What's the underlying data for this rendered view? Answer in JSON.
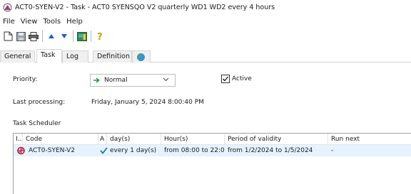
{
  "window": {
    "title": "ACT0-SYEN-V2 - Task - ACT0 SYENSQO  V2 quarterly WD1 WD2 every 4 hours"
  },
  "menu": {
    "items": [
      "File",
      "View",
      "Tools",
      "Help"
    ]
  },
  "toolbar": {
    "icons": [
      "new-document-icon",
      "save-icon",
      "print-icon",
      "arrow-up-icon",
      "arrow-down-icon",
      "window-icon",
      "help-icon"
    ]
  },
  "tabs": [
    {
      "label": "General",
      "active": false
    },
    {
      "label": "Task",
      "active": true
    },
    {
      "label": "Log",
      "active": false
    },
    {
      "label": "Definition",
      "active": false
    },
    {
      "label": "",
      "icon": "globe-icon",
      "active": false
    }
  ],
  "task": {
    "priority_label": "Priority:",
    "priority_value": "Normal",
    "active_label": "Active",
    "active_checked": true,
    "last_processing_label": "Last processing:",
    "last_processing_value": "Friday, January 5, 2024 8:00:40 PM",
    "scheduler_label": "Task Scheduler"
  },
  "scheduler": {
    "columns": [
      "I..",
      "Code",
      "A",
      "day(s)",
      "Hour(s)",
      "Period of validity",
      "Run next"
    ],
    "rows": [
      {
        "code": "ACT0-SYEN-V2",
        "active_icon": "checkmark-icon",
        "days": "every 1 day(s)",
        "hours": "from 08:00 to 22:0...",
        "period": "from 1/2/2024 to 1/5/2024",
        "run_next": "-"
      }
    ]
  },
  "colors": {
    "selection": "#e5f3ff",
    "check_blue": "#1a6fd4",
    "arrow_green": "#1a9f3a",
    "arrow_blue": "#1f5fc4"
  }
}
